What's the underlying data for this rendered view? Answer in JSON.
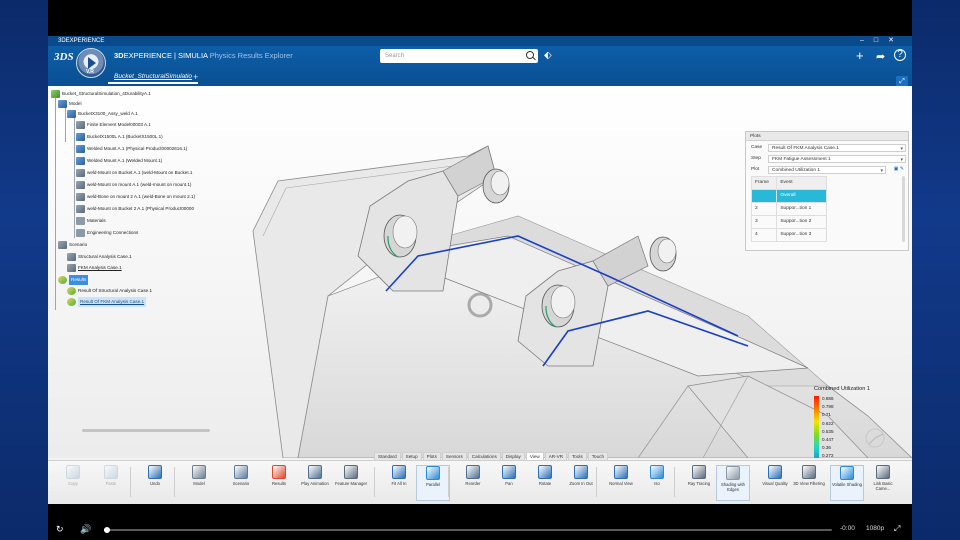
{
  "window": {
    "title": "3DEXPERIENCE",
    "controls": [
      "–",
      "□",
      "✕"
    ]
  },
  "header": {
    "brand_prefix": "3D",
    "brand_main": "EXPERIENCE | SIMULIA",
    "brand_app": "Physics Results Explorer",
    "document_tab": "Bucket_StructuralSimulatio",
    "tab_add": "+",
    "search_placeholder": "Search",
    "compass_label": "V.R",
    "icons": [
      "plus-icon",
      "share-icon",
      "help-icon"
    ]
  },
  "tree": {
    "root": "Bucket_StructuralSimulation_4DurabilityA.1",
    "model": "Model",
    "assembly": "BucketX3100_Assy_weld A.1",
    "children": [
      "Finite Element Model00003 A.1",
      "BucketX1500L A.1 (BucketX1500L.1)",
      "Welded Mount A.1 (Physical Product00002616.1)",
      "Welded Mount A.1 (Welded Mount.1)",
      "weld-Mount on Bucket A.1 (weld-Mount on Bucket.1",
      "weld-Mount on mount A.1 (weld-mount on mount.1)",
      "weld-Bone on mount 2 A.1 (weld-Bone on mount 2.1)",
      "weld-Mount on Bucket 2 A.1 (Physical Product00000",
      "Materials",
      "Engineering Connections"
    ],
    "scenario": "Scenario",
    "scenario_items": [
      "Structural Analysis Case.1",
      "FKM Analysis Case.1"
    ],
    "results": "Results",
    "result_items": [
      "Result Of Structural Analysis Case.1",
      "Result Of FKM Analysis Case.1"
    ]
  },
  "panel": {
    "title": "Plots",
    "case_label": "Case",
    "case_value": "Result Of FKM Analysis Case.1",
    "step_label": "Step",
    "step_value": "FKM Fatigue Assessment 1",
    "plot_label": "Plot",
    "plot_value": "Combined Utilization 1",
    "table_headers": [
      "Frame",
      "Event"
    ],
    "rows": [
      {
        "frame": "",
        "event": "Overall"
      },
      {
        "frame": "2",
        "event": "Suppor...tion 1"
      },
      {
        "frame": "3",
        "event": "Suppor...tion 2"
      },
      {
        "frame": "4",
        "event": "Suppor...tion 3"
      }
    ],
    "selected_row": 0
  },
  "legend": {
    "title": "Combined Utilization 1",
    "values": [
      "0.888",
      "0.798",
      "0.71",
      "0.622",
      "0.535",
      "0.447",
      "0.36",
      "0.272",
      "0.184",
      "0.0967",
      "0.0091"
    ]
  },
  "ribbon": {
    "tabs": [
      "Standard",
      "Setup",
      "Plots",
      "Sensors",
      "Calculations",
      "Display",
      "View",
      "AR-VR",
      "Tools",
      "Touch"
    ],
    "active_tab": "View",
    "tools": [
      {
        "label": "Copy",
        "dim": true,
        "color": "#8aa8c8"
      },
      {
        "label": "Paste",
        "dim": true,
        "color": "#8aa8c8"
      },
      {
        "label": "Undo",
        "dim": false,
        "color": "#2a6fb8"
      },
      {
        "label": "Model",
        "dim": false,
        "color": "#6b7c8f"
      },
      {
        "label": "Scenario",
        "dim": false,
        "color": "#5d7c9c"
      },
      {
        "label": "Results",
        "dim": false,
        "color": "#e2462c"
      },
      {
        "label": "Play Animation",
        "dim": false,
        "color": "#4f6f91"
      },
      {
        "label": "Feature Manager",
        "dim": false,
        "color": "#5a6b7c"
      },
      {
        "label": "Fit All In",
        "dim": false,
        "color": "#2a6fb8"
      },
      {
        "label": "Parallel",
        "dim": false,
        "color": "#2a8ad8"
      },
      {
        "label": "Reorder",
        "dim": false,
        "color": "#4f6f91"
      },
      {
        "label": "Pan",
        "dim": false,
        "color": "#2a6fb8"
      },
      {
        "label": "Rotate",
        "dim": false,
        "color": "#2a6fb8"
      },
      {
        "label": "Zoom In Out",
        "dim": false,
        "color": "#2a6fb8"
      },
      {
        "label": "Normal View",
        "dim": false,
        "color": "#2a6fb8"
      },
      {
        "label": "Iso",
        "dim": false,
        "color": "#2a8ad8"
      },
      {
        "label": "Ray Tracing",
        "dim": false,
        "color": "#5a6b7c"
      },
      {
        "label": "Shading with Edges",
        "dim": false,
        "color": "#8a98a8"
      },
      {
        "label": "Visual Quality",
        "dim": false,
        "color": "#2a6fb8"
      },
      {
        "label": "3D View Filtering",
        "dim": false,
        "color": "#5a6b7c"
      },
      {
        "label": "Volatile Shading",
        "dim": false,
        "color": "#2a8ad8"
      },
      {
        "label": "Link Basic Came...",
        "dim": false,
        "color": "#5a6b7c"
      }
    ]
  },
  "video": {
    "time_remaining": "-0:00",
    "quality": "1080p",
    "progress": 0.004
  }
}
